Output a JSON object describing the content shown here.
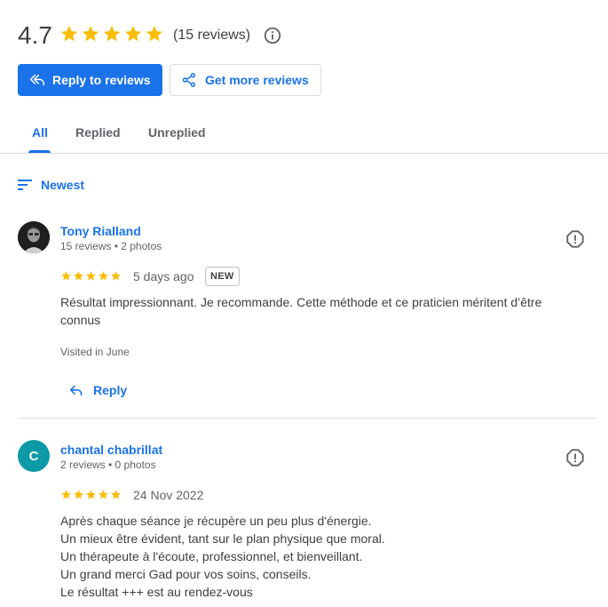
{
  "summary": {
    "rating": "4.7",
    "stars": 5,
    "count_text": "(15 reviews)"
  },
  "actions": {
    "reply_label": "Reply to reviews",
    "get_more_label": "Get more reviews"
  },
  "tabs": [
    {
      "label": "All",
      "active": true
    },
    {
      "label": "Replied",
      "active": false
    },
    {
      "label": "Unreplied",
      "active": false
    }
  ],
  "sort": {
    "label": "Newest"
  },
  "colors": {
    "accent": "#1a73e8",
    "star": "#fbbc04",
    "avatar_letter_bg": "#0b9aa6"
  },
  "reviews": [
    {
      "name": "Tony Rialland",
      "meta": "15 reviews • 2 photos",
      "stars": 5,
      "date": "5 days ago",
      "badge": "NEW",
      "text": "Résultat impressionnant. Je recommande. Cette méthode et ce praticien méritent d’être connus",
      "visited": "Visited in June",
      "reply_label": "Reply"
    },
    {
      "name": "chantal chabrillat",
      "avatar_letter": "C",
      "meta": "2 reviews • 0 photos",
      "stars": 5,
      "date": "24 Nov 2022",
      "text_lines": [
        "Après chaque séance je récupère un peu plus d'énergie.",
        "Un mieux être évident, tant sur le plan physique que moral.",
        "Un thérapeute à l'écoute, professionnel, et bienveillant.",
        "Un grand merci Gad pour vos soins, conseils.",
        "Le résultat +++ est au rendez-vous"
      ]
    }
  ]
}
